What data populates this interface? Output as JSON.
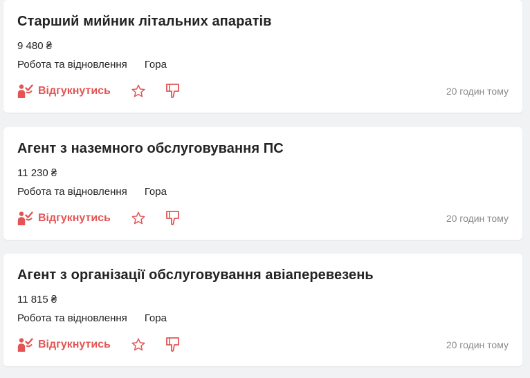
{
  "colors": {
    "accent": "#e45454",
    "background": "#f1f2f4",
    "card": "#ffffff",
    "muted_text": "#8a8a8a"
  },
  "icons": {
    "respond": "person-check-icon",
    "favorite": "star-outline-icon",
    "dislike": "thumbs-down-icon"
  },
  "vacancies": [
    {
      "title": "Старший мийник літальних апаратів",
      "salary": "9 480 ₴",
      "category": "Робота та відновлення",
      "city": "Гора",
      "respond_label": "Відгукнутись",
      "posted": "20 годин тому"
    },
    {
      "title": "Агент з наземного обслуговування ПС",
      "salary": "11 230 ₴",
      "category": "Робота та відновлення",
      "city": "Гора",
      "respond_label": "Відгукнутись",
      "posted": "20 годин тому"
    },
    {
      "title": "Агент з організації обслуговування авіаперевезень",
      "salary": "11 815 ₴",
      "category": "Робота та відновлення",
      "city": "Гора",
      "respond_label": "Відгукнутись",
      "posted": "20 годин тому"
    }
  ]
}
